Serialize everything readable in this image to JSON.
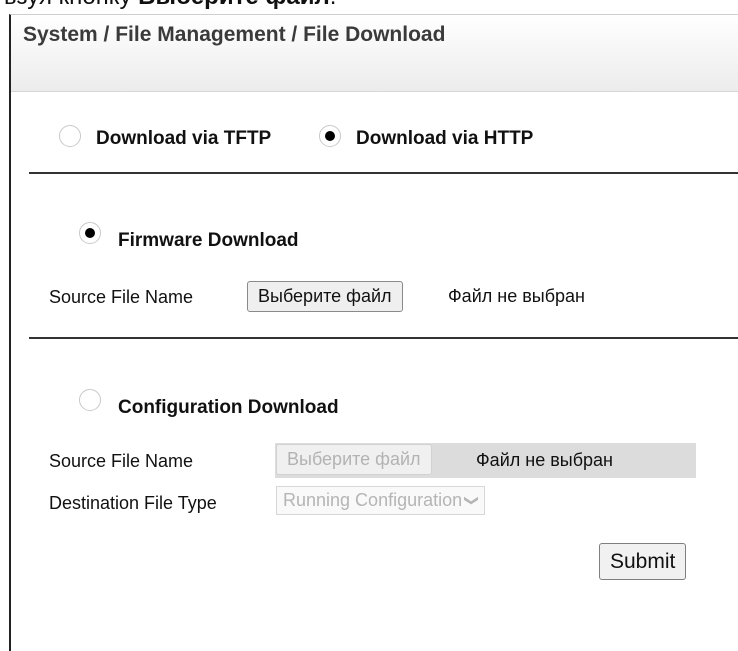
{
  "top_cut_text": {
    "prefix": "ьзуя кнопку ",
    "bold": "Выберите файл",
    "suffix": "."
  },
  "header": {
    "breadcrumb": "System / File Management / File Download"
  },
  "protocol": {
    "options": [
      {
        "label": "Download via TFTP",
        "checked": false
      },
      {
        "label": "Download via HTTP",
        "checked": true
      }
    ]
  },
  "firmware": {
    "label": "Firmware Download",
    "checked": true,
    "source_label": "Source File Name",
    "choose_button": "Выберите файл",
    "file_status": "Файл не выбран"
  },
  "configuration": {
    "label": "Configuration Download",
    "checked": false,
    "source_label": "Source File Name",
    "choose_button": "Выберите файл",
    "file_status": "Файл не выбран",
    "dest_label": "Destination File Type",
    "dest_value": "Running Configuration",
    "disabled": true
  },
  "submit_label": "Submit",
  "colors": {
    "header_top": "#ffffff",
    "header_bottom": "#ececec",
    "disabled_bg": "#dcdcdc"
  },
  "icons": {
    "dropdown": "chevron-down-icon"
  }
}
